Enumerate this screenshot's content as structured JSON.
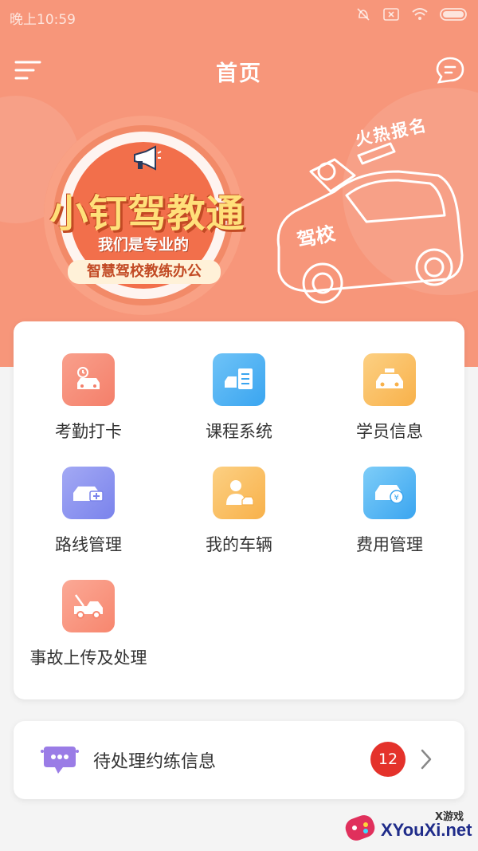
{
  "status_bar": {
    "time": "晚上10:59"
  },
  "header": {
    "title": "首页"
  },
  "banner": {
    "title": "小钉驾教通",
    "subtitle": "我们是专业的",
    "tagline": "智慧驾校教练办公",
    "hot_label": "火热报名",
    "car_label": "驾校"
  },
  "features": [
    {
      "label": "考勤打卡",
      "icon": "attendance-car-clock-icon",
      "color": "#f47f6a"
    },
    {
      "label": "课程系统",
      "icon": "course-schedule-icon",
      "color": "#3aa5f0"
    },
    {
      "label": "学员信息",
      "icon": "student-car-icon",
      "color": "#f8b14a"
    },
    {
      "label": "路线管理",
      "icon": "route-car-icon",
      "color": "#7a83ec"
    },
    {
      "label": "我的车辆",
      "icon": "my-vehicle-icon",
      "color": "#f8b14a"
    },
    {
      "label": "费用管理",
      "icon": "fee-car-icon",
      "color": "#3aa5f0"
    },
    {
      "label": "事故上传及处理",
      "icon": "accident-tow-truck-icon",
      "color": "#f7866e"
    }
  ],
  "pending": {
    "label": "待处理约练信息",
    "count": "12"
  },
  "watermark": {
    "brand": "XYouXi.net",
    "small": "X游戏"
  }
}
